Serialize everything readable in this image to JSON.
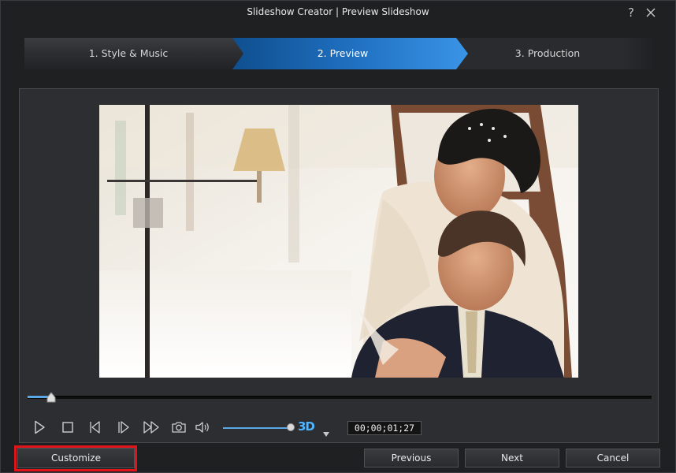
{
  "window": {
    "title": "Slideshow Creator | Preview Slideshow",
    "help_glyph": "?"
  },
  "steps": [
    {
      "label": "1. Style & Music",
      "active": false
    },
    {
      "label": "2. Preview",
      "active": true
    },
    {
      "label": "3. Production",
      "active": false
    }
  ],
  "preview": {
    "image_alt": "Wedding photo of a bride embracing a groom by a window",
    "playback_progress": 0.038,
    "volume_level": 0.95,
    "timecode": "00;00;01;27"
  },
  "controls": {
    "play_icon": "play-icon",
    "stop_icon": "stop-icon",
    "prev_frame_icon": "previous-frame-icon",
    "next_frame_icon": "next-frame-icon",
    "fast_forward_icon": "fast-forward-icon",
    "snapshot_icon": "camera-icon",
    "volume_icon": "volume-icon",
    "three_d_label": "3D"
  },
  "buttons": {
    "customize": "Customize",
    "previous": "Previous",
    "next": "Next",
    "cancel": "Cancel"
  },
  "colors": {
    "accent": "#2e86d6",
    "highlight_box": "#e0141a",
    "background": "#1f2022"
  }
}
